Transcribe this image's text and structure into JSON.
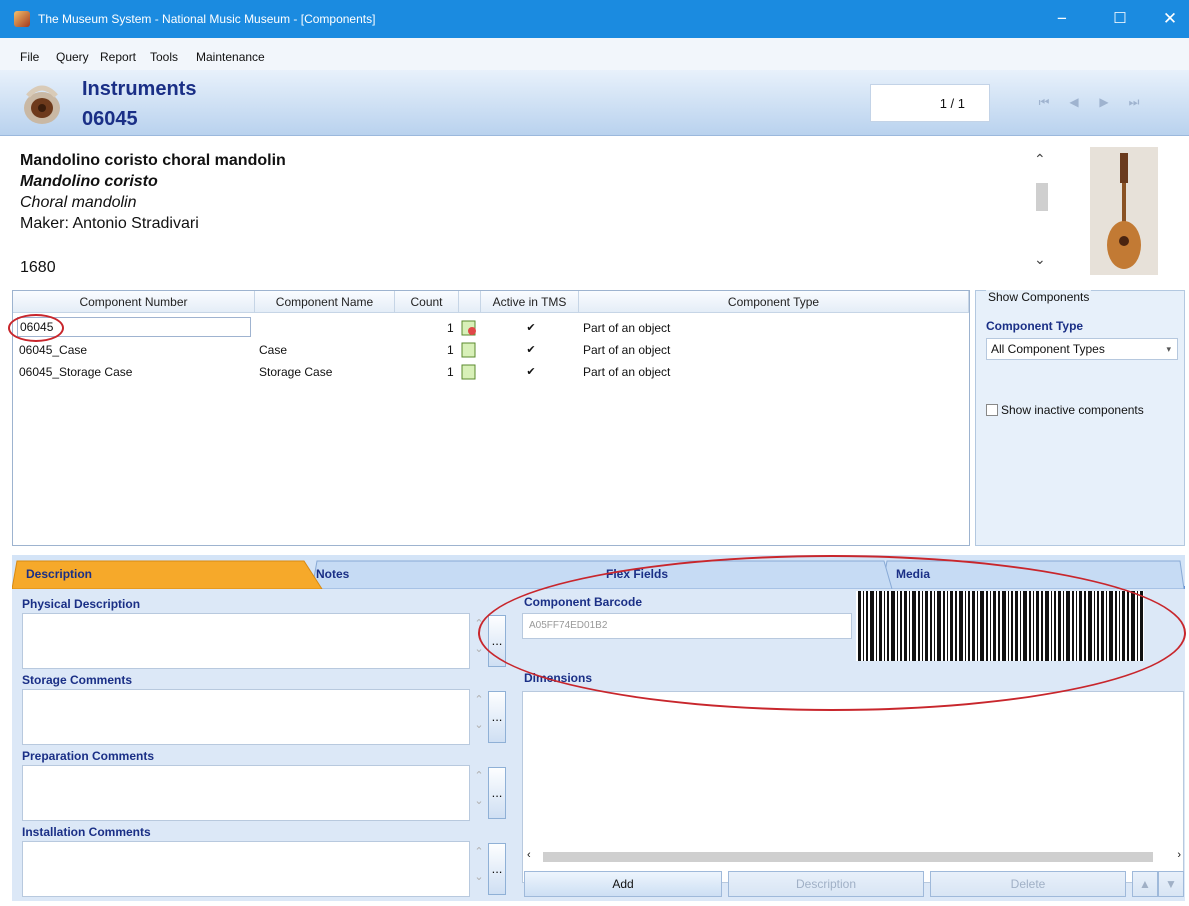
{
  "window": {
    "title": "The Museum System - National Music Museum - [Components]",
    "minimize": "−",
    "maximize": "☐",
    "close": "✕"
  },
  "menu": [
    "File",
    "Query",
    "Report",
    "Tools",
    "Maintenance"
  ],
  "header": {
    "module": "Instruments",
    "object_number": "06045",
    "record_counter": "1 / 1",
    "nav": [
      "⏮",
      "◀",
      "▶",
      "⏭"
    ]
  },
  "summary": {
    "title": "Mandolino coristo choral mandolin",
    "italic_title": "Mandolino coristo",
    "subtitle": "Choral mandolin",
    "maker": "Maker: Antonio Stradivari",
    "date": "1680"
  },
  "grid": {
    "columns": [
      "Component Number",
      "Component Name",
      "Count",
      "",
      "Active in TMS",
      "Component Type"
    ],
    "rows": [
      {
        "number": "06045",
        "name": "",
        "count": "1",
        "active": "✔",
        "type": "Part of an object"
      },
      {
        "number": "06045_Case",
        "name": "Case",
        "count": "1",
        "active": "✔",
        "type": "Part of an object"
      },
      {
        "number": "06045_Storage Case",
        "name": "Storage Case",
        "count": "1",
        "active": "✔",
        "type": "Part of an object"
      }
    ]
  },
  "show_components": {
    "legend": "Show Components",
    "type_label": "Component Type",
    "type_value": "All Component Types",
    "show_inactive": "Show inactive components"
  },
  "tabs": [
    "Description",
    "Notes",
    "Flex Fields",
    "Media"
  ],
  "description_tab": {
    "physical_description": "Physical Description",
    "storage_comments": "Storage Comments",
    "preparation_comments": "Preparation Comments",
    "installation_comments": "Installation Comments",
    "component_barcode": "Component Barcode",
    "barcode_value": "A05FF74ED01B2",
    "dimensions": "Dimensions",
    "ellipsis": "...",
    "buttons": {
      "add": "Add",
      "description": "Description",
      "delete": "Delete"
    },
    "up_arrow": "▲",
    "down_arrow": "▼"
  },
  "colors": {
    "titlebar": "#1b8be0",
    "accent_text": "#1a2f86",
    "annotation": "#c8262c",
    "active_tab": "#f6a92a"
  }
}
